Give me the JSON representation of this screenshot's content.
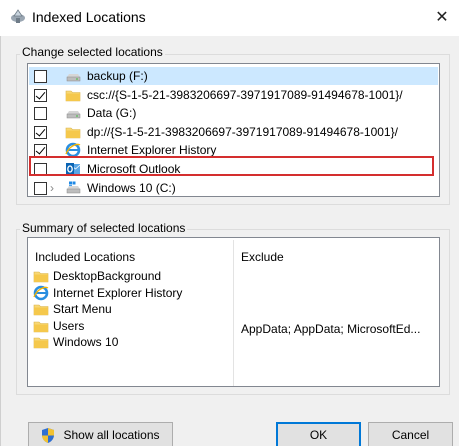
{
  "window": {
    "title": "Indexed Locations",
    "close_glyph": "✕"
  },
  "change_group": {
    "label": "Change selected locations",
    "rows": [
      {
        "label": "backup (F:)",
        "checked": false,
        "icon": "drive-icon",
        "selected": true,
        "expandable": false
      },
      {
        "label": "csc://{S-1-5-21-3983206697-3971917089-91494678-1001}/",
        "checked": true,
        "icon": "folder-icon",
        "selected": false,
        "expandable": false
      },
      {
        "label": "Data (G:)",
        "checked": false,
        "icon": "drive-icon",
        "selected": false,
        "expandable": false
      },
      {
        "label": "dp://{S-1-5-21-3983206697-3971917089-91494678-1001}/",
        "checked": true,
        "icon": "folder-icon",
        "selected": false,
        "expandable": false
      },
      {
        "label": "Internet Explorer History",
        "checked": true,
        "icon": "ie-icon",
        "selected": false,
        "expandable": false
      },
      {
        "label": "Microsoft Outlook",
        "checked": false,
        "icon": "outlook-icon",
        "selected": false,
        "expandable": false
      },
      {
        "label": "Windows 10 (C:)",
        "checked": false,
        "icon": "windows-drive-icon",
        "selected": false,
        "expandable": true
      }
    ]
  },
  "summary_group": {
    "label": "Summary of selected locations",
    "included_header": "Included Locations",
    "exclude_header": "Exclude",
    "included": [
      {
        "label": "DesktopBackground",
        "icon": "folder-icon"
      },
      {
        "label": "Internet Explorer History",
        "icon": "ie-icon"
      },
      {
        "label": "Start Menu",
        "icon": "folder-icon"
      },
      {
        "label": "Users",
        "icon": "folder-icon"
      },
      {
        "label": "Windows 10",
        "icon": "folder-icon"
      }
    ],
    "excluded_users": "AppData; AppData; MicrosoftEd..."
  },
  "buttons": {
    "show_all": "Show all locations",
    "ok": "OK",
    "cancel": "Cancel"
  }
}
